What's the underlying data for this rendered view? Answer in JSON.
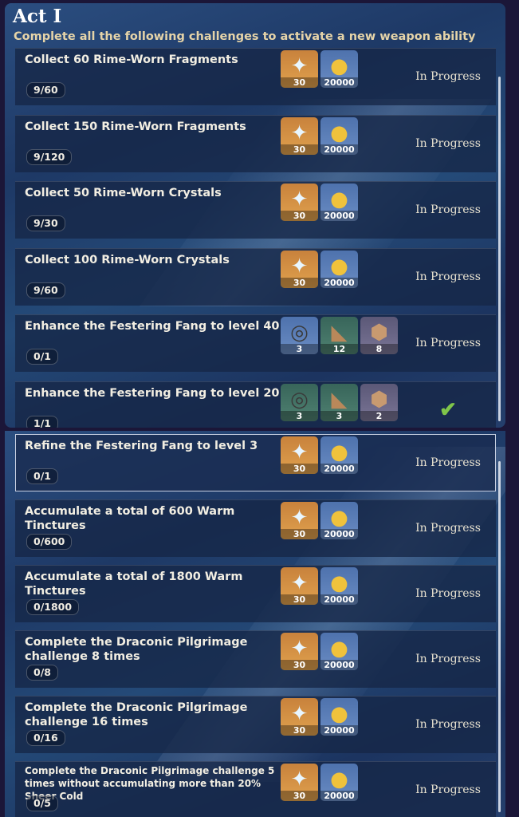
{
  "header": {
    "title": "Act I",
    "subtitle": "Complete all the following challenges to activate a new weapon ability"
  },
  "challenges_top": [
    {
      "title": "Collect 60 Rime-Worn Fragments",
      "progress": "9/60",
      "rewards": [
        {
          "icon": "primogem-star-icon",
          "qty": "30",
          "bg": "gold"
        },
        {
          "icon": "mora-coin-icon",
          "qty": "20000",
          "bg": "blue"
        }
      ],
      "status": "In Progress"
    },
    {
      "title": "Collect 150 Rime-Worn Fragments",
      "progress": "9/120",
      "rewards": [
        {
          "icon": "primogem-star-icon",
          "qty": "30",
          "bg": "gold"
        },
        {
          "icon": "mora-coin-icon",
          "qty": "20000",
          "bg": "blue"
        }
      ],
      "status": "In Progress"
    },
    {
      "title": "Collect 50 Rime-Worn Crystals",
      "progress": "9/30",
      "rewards": [
        {
          "icon": "primogem-star-icon",
          "qty": "30",
          "bg": "gold"
        },
        {
          "icon": "mora-coin-icon",
          "qty": "20000",
          "bg": "blue"
        }
      ],
      "status": "In Progress"
    },
    {
      "title": "Collect 100 Rime-Worn Crystals",
      "progress": "9/60",
      "rewards": [
        {
          "icon": "primogem-star-icon",
          "qty": "30",
          "bg": "gold"
        },
        {
          "icon": "mora-coin-icon",
          "qty": "20000",
          "bg": "blue"
        }
      ],
      "status": "In Progress"
    },
    {
      "title": "Enhance the Festering Fang to level 40",
      "progress": "0/1",
      "rewards": [
        {
          "icon": "material-ring-icon",
          "qty": "3",
          "bg": "blue"
        },
        {
          "icon": "material-horn-icon",
          "qty": "12",
          "bg": "green"
        },
        {
          "icon": "material-emblem-icon",
          "qty": "8",
          "bg": "purple"
        }
      ],
      "status": "In Progress"
    },
    {
      "title": "Enhance the Festering Fang to level 20",
      "progress": "1/1",
      "rewards": [
        {
          "icon": "material-ring-icon",
          "qty": "3",
          "bg": "green"
        },
        {
          "icon": "material-horn-icon",
          "qty": "3",
          "bg": "green"
        },
        {
          "icon": "material-emblem-icon",
          "qty": "2",
          "bg": "purple"
        }
      ],
      "status": "",
      "completed": true
    }
  ],
  "challenges_bottom": [
    {
      "title": "Refine the Festering Fang to level 3",
      "progress": "0/1",
      "rewards": [
        {
          "icon": "primogem-star-icon",
          "qty": "30",
          "bg": "gold"
        },
        {
          "icon": "mora-coin-icon",
          "qty": "20000",
          "bg": "blue"
        }
      ],
      "status": "In Progress",
      "selected": true
    },
    {
      "title": "Accumulate a total of 600 Warm Tinctures",
      "progress": "0/600",
      "rewards": [
        {
          "icon": "primogem-star-icon",
          "qty": "30",
          "bg": "gold"
        },
        {
          "icon": "mora-coin-icon",
          "qty": "20000",
          "bg": "blue"
        }
      ],
      "status": "In Progress"
    },
    {
      "title": "Accumulate a total of 1800 Warm Tinctures",
      "progress": "0/1800",
      "rewards": [
        {
          "icon": "primogem-star-icon",
          "qty": "30",
          "bg": "gold"
        },
        {
          "icon": "mora-coin-icon",
          "qty": "20000",
          "bg": "blue"
        }
      ],
      "status": "In Progress"
    },
    {
      "title": "Complete the Draconic Pilgrimage challenge 8 times",
      "progress": "0/8",
      "rewards": [
        {
          "icon": "primogem-star-icon",
          "qty": "30",
          "bg": "gold"
        },
        {
          "icon": "mora-coin-icon",
          "qty": "20000",
          "bg": "blue"
        }
      ],
      "status": "In Progress"
    },
    {
      "title": "Complete the Draconic Pilgrimage challenge 16 times",
      "progress": "0/16",
      "rewards": [
        {
          "icon": "primogem-star-icon",
          "qty": "30",
          "bg": "gold"
        },
        {
          "icon": "mora-coin-icon",
          "qty": "20000",
          "bg": "blue"
        }
      ],
      "status": "In Progress"
    },
    {
      "title": "Complete the Draconic Pilgrimage challenge 5 times without accumulating more than 20% Sheer Cold",
      "progress": "0/5",
      "rewards": [
        {
          "icon": "primogem-star-icon",
          "qty": "30",
          "bg": "gold"
        },
        {
          "icon": "mora-coin-icon",
          "qty": "20000",
          "bg": "blue"
        }
      ],
      "status": "In Progress",
      "small": true
    }
  ],
  "colors": {
    "completed_check": "#7fc54a",
    "subtitle": "#e6d4a8"
  }
}
